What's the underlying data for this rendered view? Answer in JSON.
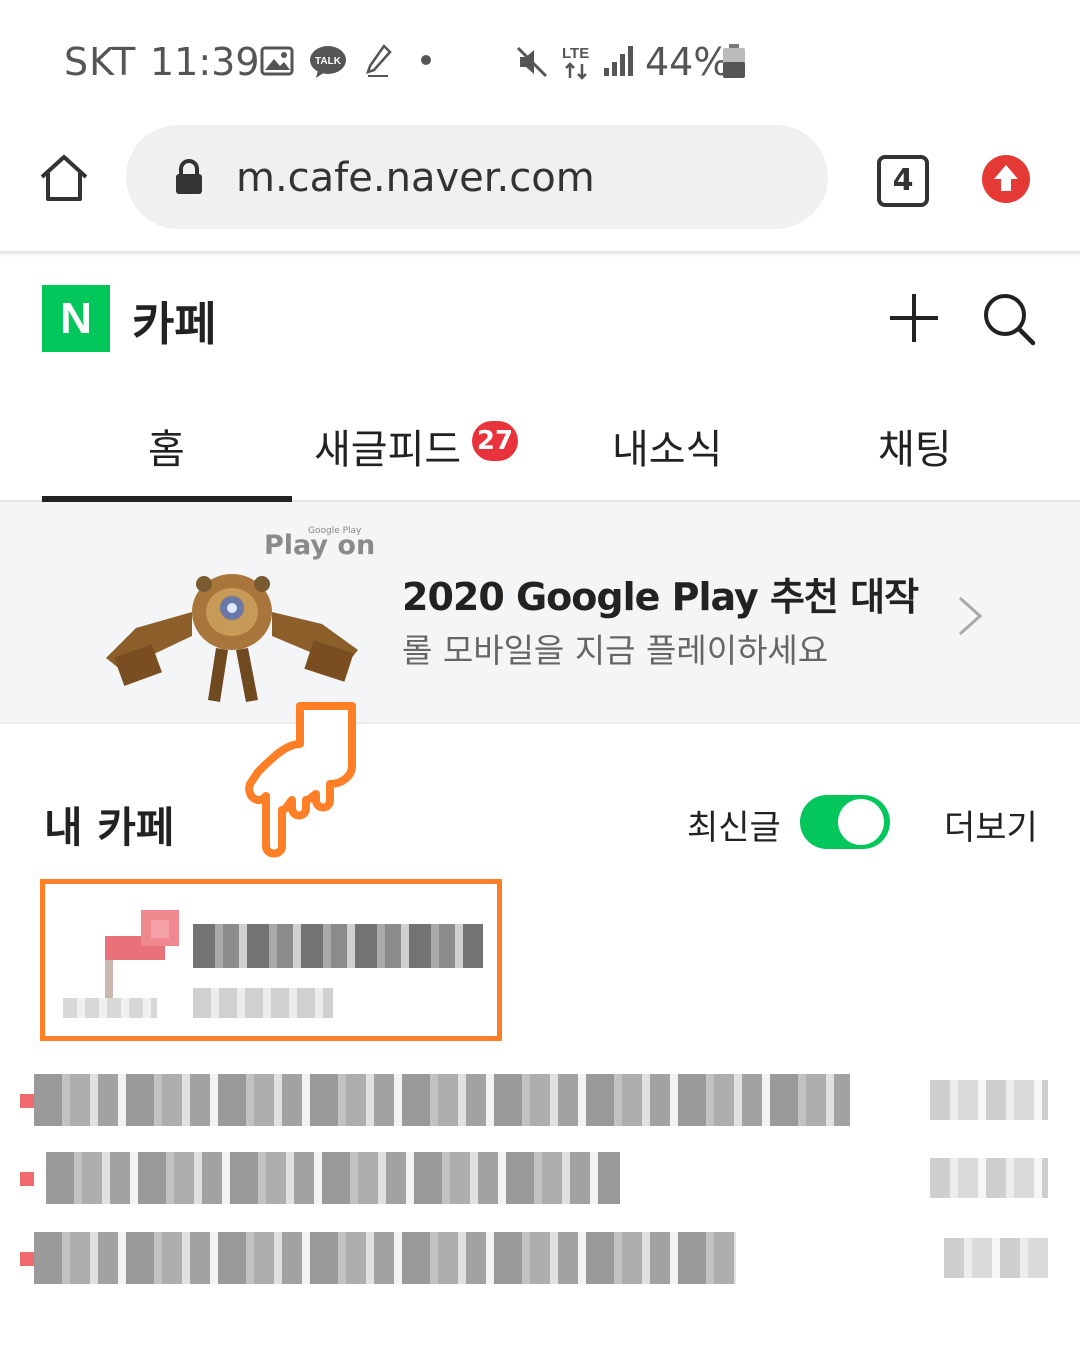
{
  "status_bar": {
    "carrier": "SKT",
    "time": "11:39",
    "battery": "44%",
    "network": "LTE"
  },
  "browser": {
    "url": "m.cafe.naver.com",
    "tab_count": "4"
  },
  "header": {
    "logo": "N",
    "title": "카페"
  },
  "tabs": [
    {
      "label": "홈",
      "active": true
    },
    {
      "label": "새글피드",
      "badge": "27"
    },
    {
      "label": "내소식"
    },
    {
      "label": "채팅"
    }
  ],
  "banner": {
    "brand": "Play on",
    "brand_small": "Google Play",
    "title": "2020 Google Play 추천 대작",
    "subtitle": "롤 모바일을 지금 플레이하세요"
  },
  "my_cafe": {
    "title": "내 카페",
    "latest_label": "최신글",
    "latest_on": true,
    "more_label": "더보기"
  },
  "colors": {
    "naver_green": "#03c75a",
    "badge_red": "#e8333c",
    "highlight_orange": "#ff7f27"
  }
}
